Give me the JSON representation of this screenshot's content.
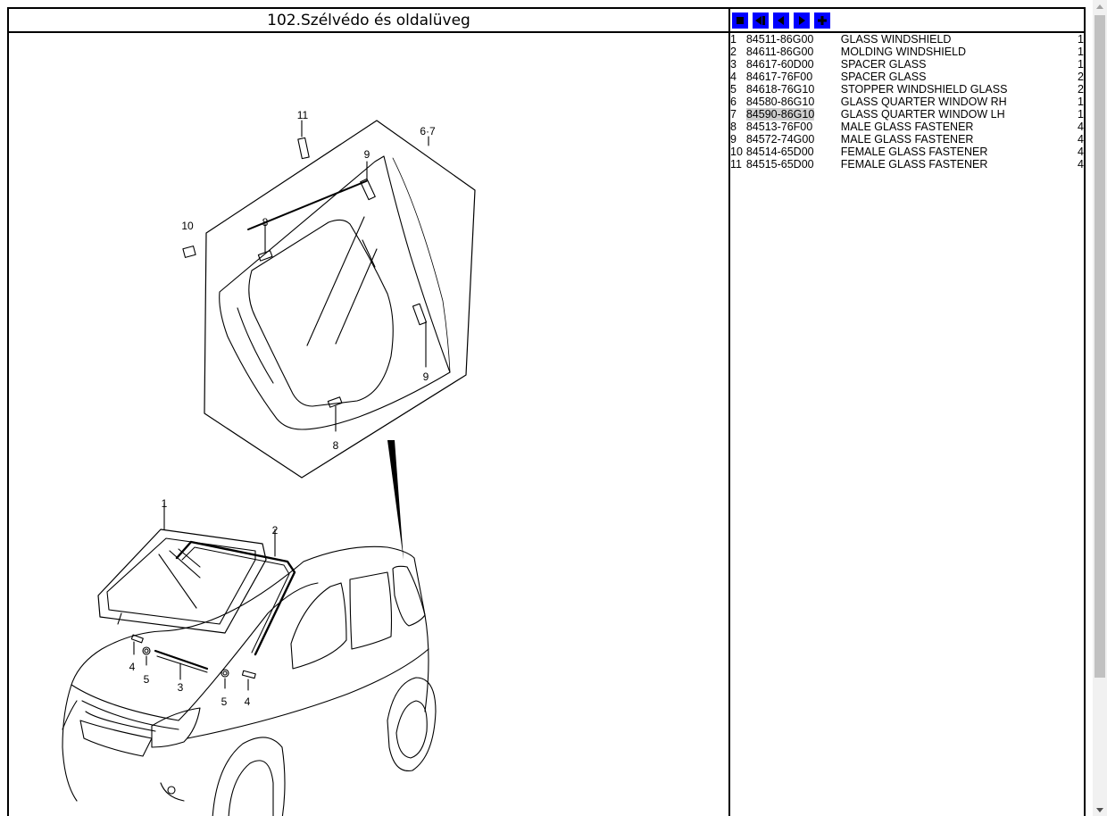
{
  "title": "102.Szélvédo és oldalüveg",
  "nav": {
    "buttons": [
      "first",
      "previous-page",
      "previous",
      "next",
      "add"
    ]
  },
  "diagram": {
    "callouts": [
      "11",
      "6·7",
      "9",
      "10",
      "8",
      "9",
      "8",
      "1",
      "2",
      "4",
      "5",
      "3",
      "5",
      "4"
    ]
  },
  "parts": [
    {
      "no": "1",
      "part_number": "84511-86G00",
      "description": "GLASS WINDSHIELD",
      "qty": "1"
    },
    {
      "no": "2",
      "part_number": "84611-86G00",
      "description": "MOLDING WINDSHIELD",
      "qty": "1"
    },
    {
      "no": "3",
      "part_number": "84617-60D00",
      "description": "SPACER GLASS",
      "qty": "1"
    },
    {
      "no": "4",
      "part_number": "84617-76F00",
      "description": "SPACER GLASS",
      "qty": "2"
    },
    {
      "no": "5",
      "part_number": "84618-76G10",
      "description": "STOPPER WINDSHIELD GLASS",
      "qty": "2"
    },
    {
      "no": "6",
      "part_number": "84580-86G10",
      "description": "GLASS QUARTER WINDOW RH",
      "qty": "1"
    },
    {
      "no": "7",
      "part_number": "84590-86G10",
      "description": "GLASS QUARTER WINDOW LH",
      "qty": "1"
    },
    {
      "no": "8",
      "part_number": "84513-76F00",
      "description": "MALE GLASS FASTENER",
      "qty": "4"
    },
    {
      "no": "9",
      "part_number": "84572-74G00",
      "description": "MALE GLASS FASTENER",
      "qty": "4"
    },
    {
      "no": "10",
      "part_number": "84514-65D00",
      "description": "FEMALE GLASS FASTENER",
      "qty": "4"
    },
    {
      "no": "11",
      "part_number": "84515-65D00",
      "description": "FEMALE GLASS FASTENER",
      "qty": "4"
    }
  ],
  "selected_row": 6,
  "colors": {
    "nav_button": "#0000ff",
    "selected_highlight": "#cfcfcf",
    "border": "#000000"
  }
}
